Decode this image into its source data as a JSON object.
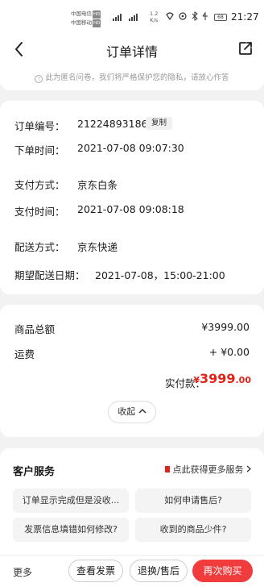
{
  "status_bar": {
    "carrier1": "中国电信",
    "carrier2": "中国移动",
    "hd": "HD",
    "signal": "⁴⁶ᴵᴵ ⁴⁶ᴵᴵ",
    "speed_value": "1.2",
    "speed_unit": "K/s",
    "battery": "68",
    "time": "21:27"
  },
  "nav": {
    "title": "订单详情"
  },
  "privacy_note": "此为匿名问卷，我们将严格保护您的隐私，请放心作答",
  "order": {
    "number_label": "订单编号：",
    "number_value": "212248931865",
    "copy_label": "复制",
    "time_label": "下单时间：",
    "time_value": "2021-07-08 09:07:30",
    "pay_method_label": "支付方式：",
    "pay_method_value": "京东白条",
    "pay_time_label": "支付时间：",
    "pay_time_value": "2021-07-08 09:08:18",
    "delivery_label": "配送方式：",
    "delivery_value": "京东快递",
    "expected_label": "期望配送日期：",
    "expected_value": "2021-07-08，15:00-21:00"
  },
  "amounts": {
    "goods_total_label": "商品总额",
    "goods_total_value": "¥3999.00",
    "shipping_label": "运费",
    "shipping_value": "+ ¥0.00",
    "paid_label": "实付款：",
    "paid_currency": "¥",
    "paid_integer": "3999",
    "paid_decimal": ".00",
    "collapse_label": "收起"
  },
  "service": {
    "title": "客户服务",
    "more_link": "点此获得更多服务",
    "faqs": [
      "订单显示完成但是没收...",
      "如何申请售后?",
      "发票信息填错如何修改?",
      "收到的商品少件?"
    ]
  },
  "bottom_bar": {
    "more": "更多",
    "invoice": "查看发票",
    "return": "退换/售后",
    "rebuy": "再次购买"
  },
  "colors": {
    "accent": "#e2231a",
    "primary_button": "#f03c3c"
  }
}
